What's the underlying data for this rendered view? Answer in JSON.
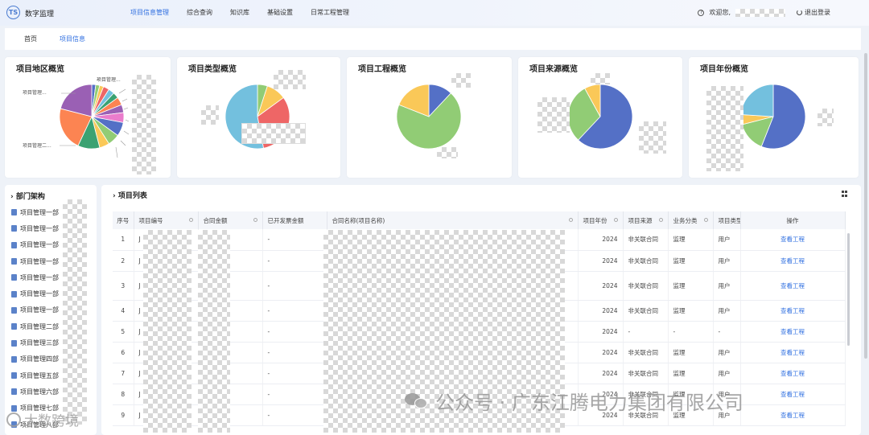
{
  "app": {
    "logo_text": "TS",
    "title": "数字监理"
  },
  "nav": [
    "项目信息管理",
    "综合查询",
    "知识库",
    "基础设置",
    "日常工程管理"
  ],
  "user": {
    "welcome": "欢迎您,",
    "logout": "退出登录"
  },
  "tabs": [
    "首页",
    "项目信息"
  ],
  "cards": [
    {
      "title": "项目地区概览",
      "labels": [
        "项目管理...",
        "项目管理...",
        "项目管理二..."
      ]
    },
    {
      "title": "项目类型概览"
    },
    {
      "title": "项目工程概览"
    },
    {
      "title": "项目来源概览"
    },
    {
      "title": "项目年份概览"
    }
  ],
  "colors": {
    "accent": "#2f6fe0",
    "blue": "#5470c6",
    "green": "#91cc75",
    "yellow": "#fac858",
    "red": "#ee6666",
    "cyan": "#73c0de",
    "orange": "#fc8452",
    "purple": "#9a60b4",
    "teal": "#3ba272"
  },
  "dept": {
    "title": "部门架构",
    "items": [
      "项目管理一部",
      "项目管理一部",
      "项目管理一部",
      "项目管理一部",
      "项目管理一部",
      "项目管理一部",
      "项目管理一部",
      "项目管理二部",
      "项目管理三部",
      "项目管理四部",
      "项目管理五部",
      "项目管理六部",
      "项目管理七部",
      "项目管理八部"
    ]
  },
  "projects": {
    "title": "项目列表",
    "columns": [
      "序号",
      "项目编号",
      "合同金额",
      "已开发票金额",
      "合同名称(项目名称)",
      "项目年份",
      "项目来源",
      "业务分类",
      "项目类型",
      "操作"
    ],
    "rows": [
      {
        "no": "1",
        "code": "J",
        "invoice": "-",
        "year": "2024",
        "source": "非关联合同",
        "category": "监理",
        "type": "用户",
        "action": "查看工程"
      },
      {
        "no": "2",
        "code": "J",
        "invoice": "-",
        "year": "2024",
        "source": "非关联合同",
        "category": "监理",
        "type": "用户",
        "action": "查看工程"
      },
      {
        "no": "3",
        "code": "J",
        "invoice": "-",
        "year": "2024",
        "source": "非关联合同",
        "category": "监理",
        "type": "用户",
        "action": "查看工程"
      },
      {
        "no": "4",
        "code": "J",
        "invoice": "-",
        "year": "2024",
        "source": "非关联合同",
        "category": "监理",
        "type": "用户",
        "action": "查看工程"
      },
      {
        "no": "5",
        "code": "J",
        "invoice": "-",
        "year": "2024",
        "source": "-",
        "category": "-",
        "type": "-",
        "action": "查看工程"
      },
      {
        "no": "6",
        "code": "J",
        "invoice": "-",
        "year": "2024",
        "source": "非关联合同",
        "category": "监理",
        "type": "用户",
        "action": "查看工程"
      },
      {
        "no": "7",
        "code": "J",
        "invoice": "-",
        "year": "2024",
        "source": "非关联合同",
        "category": "监理",
        "type": "用户",
        "action": "查看工程"
      },
      {
        "no": "8",
        "code": "J",
        "invoice": "-",
        "year": "2024",
        "source": "非关联合同",
        "category": "监理",
        "type": "用户",
        "action": "查看工程"
      },
      {
        "no": "9",
        "code": "J",
        "invoice": "-",
        "year": "2024",
        "source": "非关联合同",
        "category": "监理",
        "type": "用户",
        "action": "查看工程"
      }
    ]
  },
  "watermark": {
    "main": "公众号 · 广东江腾电力集团有限公司",
    "secondary": "大数跨境"
  }
}
